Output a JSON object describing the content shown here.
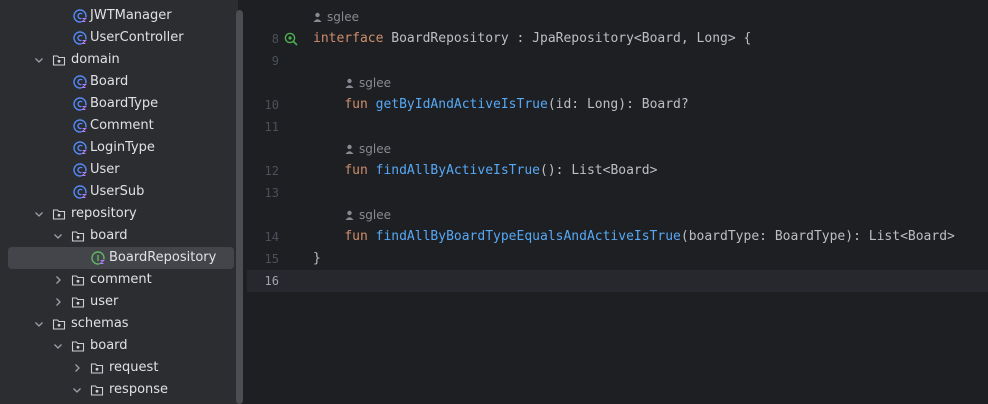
{
  "project_tree": {
    "items": [
      {
        "label": "JWTManager",
        "icon": "kotlin-class-icon",
        "expanded": null
      },
      {
        "label": "UserController",
        "icon": "kotlin-class-icon",
        "expanded": null
      },
      {
        "label": "domain",
        "icon": "package-folder-icon",
        "expanded": true
      },
      {
        "label": "Board",
        "icon": "kotlin-class-icon",
        "expanded": null
      },
      {
        "label": "BoardType",
        "icon": "kotlin-class-icon",
        "expanded": null
      },
      {
        "label": "Comment",
        "icon": "kotlin-class-icon",
        "expanded": null
      },
      {
        "label": "LoginType",
        "icon": "kotlin-class-icon",
        "expanded": null
      },
      {
        "label": "User",
        "icon": "kotlin-class-icon",
        "expanded": null
      },
      {
        "label": "UserSub",
        "icon": "kotlin-class-icon",
        "expanded": null
      },
      {
        "label": "repository",
        "icon": "package-folder-icon",
        "expanded": true
      },
      {
        "label": "board",
        "icon": "package-folder-icon",
        "expanded": true
      },
      {
        "label": "BoardRepository",
        "icon": "kotlin-interface-icon",
        "expanded": null,
        "selected": true
      },
      {
        "label": "comment",
        "icon": "package-folder-icon",
        "expanded": false
      },
      {
        "label": "user",
        "icon": "package-folder-icon",
        "expanded": false
      },
      {
        "label": "schemas",
        "icon": "package-folder-icon",
        "expanded": true
      },
      {
        "label": "board",
        "icon": "package-folder-icon",
        "expanded": true
      },
      {
        "label": "request",
        "icon": "package-folder-icon",
        "expanded": false
      },
      {
        "label": "response",
        "icon": "package-folder-icon",
        "expanded": true
      }
    ]
  },
  "editor": {
    "author": "sglee",
    "current_line": "16",
    "lines": [
      {
        "num": "8",
        "code": "interface BoardRepository : JpaRepository<Board, Long> {"
      },
      {
        "num": "9",
        "code": ""
      },
      {
        "num": "10",
        "code": "    fun getByIdAndActiveIsTrue(id: Long): Board?"
      },
      {
        "num": "11",
        "code": ""
      },
      {
        "num": "12",
        "code": "    fun findAllByActiveIsTrue(): List<Board>"
      },
      {
        "num": "13",
        "code": ""
      },
      {
        "num": "14",
        "code": "    fun findAllByBoardTypeEqualsAndActiveIsTrue(boardType: BoardType): List<Board>"
      },
      {
        "num": "15",
        "code": "}"
      },
      {
        "num": "16",
        "code": ""
      }
    ],
    "colors": {
      "keyword": "#cf8e6d",
      "function": "#56a8f5",
      "text": "#bcbec4",
      "gutter_icon": "#4caf50"
    }
  }
}
